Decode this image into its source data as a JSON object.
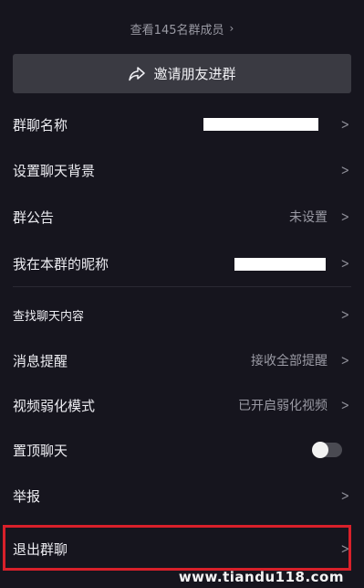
{
  "header": {
    "members_link": "查看145名群成员",
    "invite_button": "邀请朋友进群"
  },
  "settings": {
    "group_name": {
      "label": "群聊名称"
    },
    "chat_background": {
      "label": "设置聊天背景"
    },
    "announcement": {
      "label": "群公告",
      "value": "未设置"
    },
    "my_nickname": {
      "label": "我在本群的昵称"
    },
    "search_history": {
      "label": "查找聊天内容"
    },
    "notifications": {
      "label": "消息提醒",
      "value": "接收全部提醒"
    },
    "video_weak_mode": {
      "label": "视频弱化模式",
      "value": "已开启弱化视频"
    },
    "pin_chat": {
      "label": "置顶聊天",
      "toggle_on": false
    },
    "report": {
      "label": "举报"
    },
    "leave_group": {
      "label": "退出群聊"
    }
  },
  "watermark": "www.tiandu118.com",
  "colors": {
    "background": "#16151e",
    "button_bg": "#3a3a42",
    "highlight_border": "#d8202a"
  }
}
